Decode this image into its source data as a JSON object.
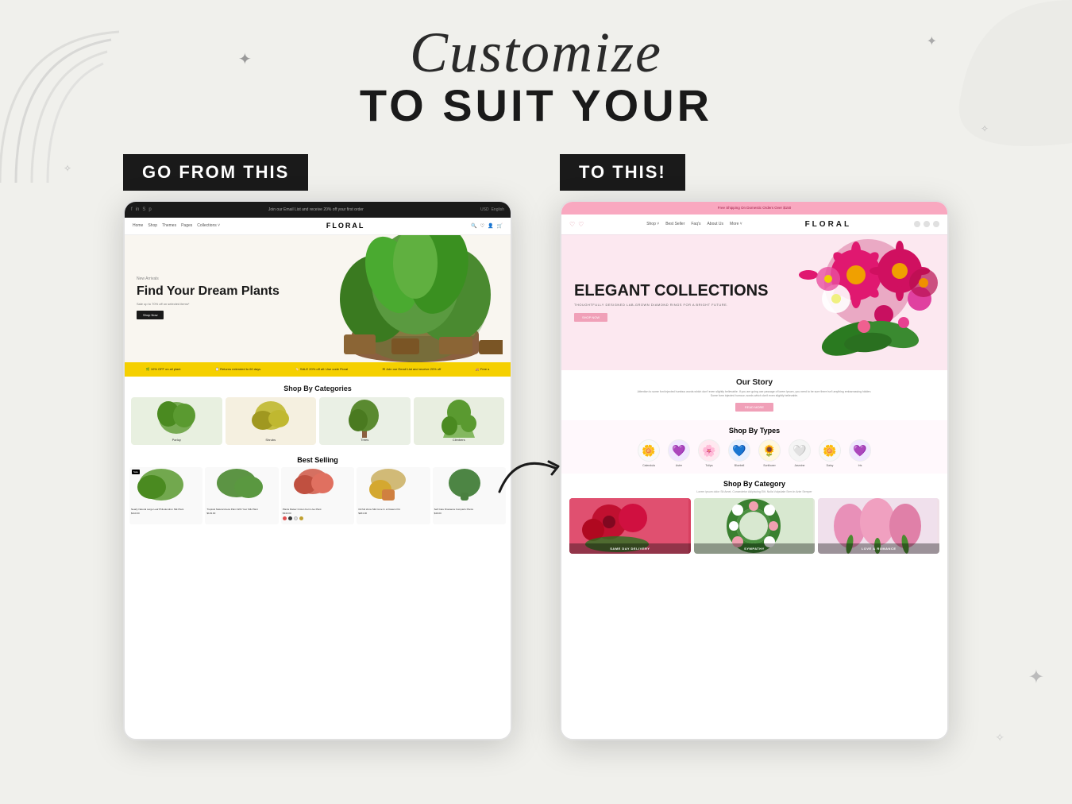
{
  "page": {
    "background_color": "#eeeeea",
    "title_cursive": "Customize",
    "title_bold": "TO SUIT YOUR",
    "badge_left": "GO FROM THIS",
    "badge_right": "TO THIS!",
    "arrow_unicode": "↗"
  },
  "decorations": {
    "sparkle_char": "✦",
    "sparkle_small": "✧",
    "arc_color": "#b8b8b8"
  },
  "left_panel": {
    "store_type": "plant",
    "topbar_text": "Join our Email List and receive 20% off your first order",
    "nav_logo": "FLORAL",
    "nav_links": [
      "Home",
      "Shop",
      "Themes",
      "Pages",
      "Collections"
    ],
    "hero_eyebrow": "New Arrivals",
    "hero_title": "Find Your Dream Plants",
    "hero_sub": "Sale up to 70% off on selected items*",
    "hero_btn": "Shop Now",
    "ticker_items": [
      "10% OFF on all plant",
      "Returns extended to 60 days",
      "SALE 20% off all: Use code Floral",
      "Join our Email List and receive 20% off",
      "Free s"
    ],
    "section_categories": "Shop By Categories",
    "categories": [
      {
        "label": "Parloy",
        "color": "#c8e0b0"
      },
      {
        "label": "Shrubs",
        "color": "#d4c870"
      },
      {
        "label": "Trees",
        "color": "#a0c880"
      },
      {
        "label": "Climbers",
        "color": "#90b870"
      }
    ],
    "section_best": "Best Selling",
    "best_items": [
      {
        "name": "Nearly Natural Large Leaf Philodendron Silk Plant",
        "price": "$110.00",
        "sale": true,
        "color": "#7ab85a"
      },
      {
        "name": "Tropical Natural Areca Palm With Your Silk Plant",
        "price": "$103.00",
        "sale": false,
        "color": "#5a9040"
      },
      {
        "name": "Plants Raiser Croton Fern Live Plant",
        "price": "$340.00",
        "sale": false,
        "color": "#e07060"
      },
      {
        "name": "Orchid show Silk Cone In a Flowers Pot",
        "price": "$264.00",
        "sale": false,
        "color": "#e09040"
      },
      {
        "name": "Self Care Dracaena Comparts Plants",
        "price": "$49.00",
        "sale": false,
        "color": "#507840"
      }
    ]
  },
  "right_panel": {
    "store_type": "flower",
    "topbar_text": "Free Shipping On Domestic Orders Over $150",
    "nav_logo": "FLORAL",
    "nav_links": [
      "Shop",
      "Best Seller",
      "Faq's",
      "About Us",
      "More"
    ],
    "hero_title": "ELEGANT COLLECTIONS",
    "hero_sub": "THOUGHTFULLY DESIGNED LAB-GROWN DIAMOND RINGS FOR A BRIGHT FUTURE.",
    "hero_btn": "SHOP NOW",
    "story_title": "Our Story",
    "story_text": "Attention to some font injected humbus words which don't even slightly believable. If you are going use passage of lorem ipsum, you need to be sure there isn't anything embarrassing hidden. Some form injected humour, words which don't even slightly believable.",
    "story_btn": "READ MORE",
    "types_title": "Shop By Types",
    "flower_types": [
      {
        "label": "Calendula",
        "emoji": "🌼"
      },
      {
        "label": "Aster",
        "emoji": "💜"
      },
      {
        "label": "Tulips",
        "emoji": "🌸"
      },
      {
        "label": "Bluebell",
        "emoji": "💙"
      },
      {
        "label": "Sunflower",
        "emoji": "🌻"
      },
      {
        "label": "Jasmine",
        "emoji": "🤍"
      },
      {
        "label": "Daisy",
        "emoji": "🌼"
      },
      {
        "label": "Iris",
        "emoji": "💜"
      }
    ],
    "categories_title": "Shop By Category",
    "categories_subtitle": "Lorem ipsum dolor Sit Amet, Consectetur Adipiscing Elit. Nulla Vulputate Sem In Ante Semper",
    "categories": [
      {
        "label": "SAME DAY DELIVERY",
        "color": "#e06070"
      },
      {
        "label": "SYMPATHY",
        "color": "#4a7a40"
      },
      {
        "label": "LOVE & ROMANCE",
        "color": "#e8a0b0"
      },
      {
        "label": "",
        "color": "#d4b840"
      },
      {
        "label": "",
        "color": "#6090c0"
      },
      {
        "label": "",
        "color": "#c07060"
      }
    ]
  }
}
